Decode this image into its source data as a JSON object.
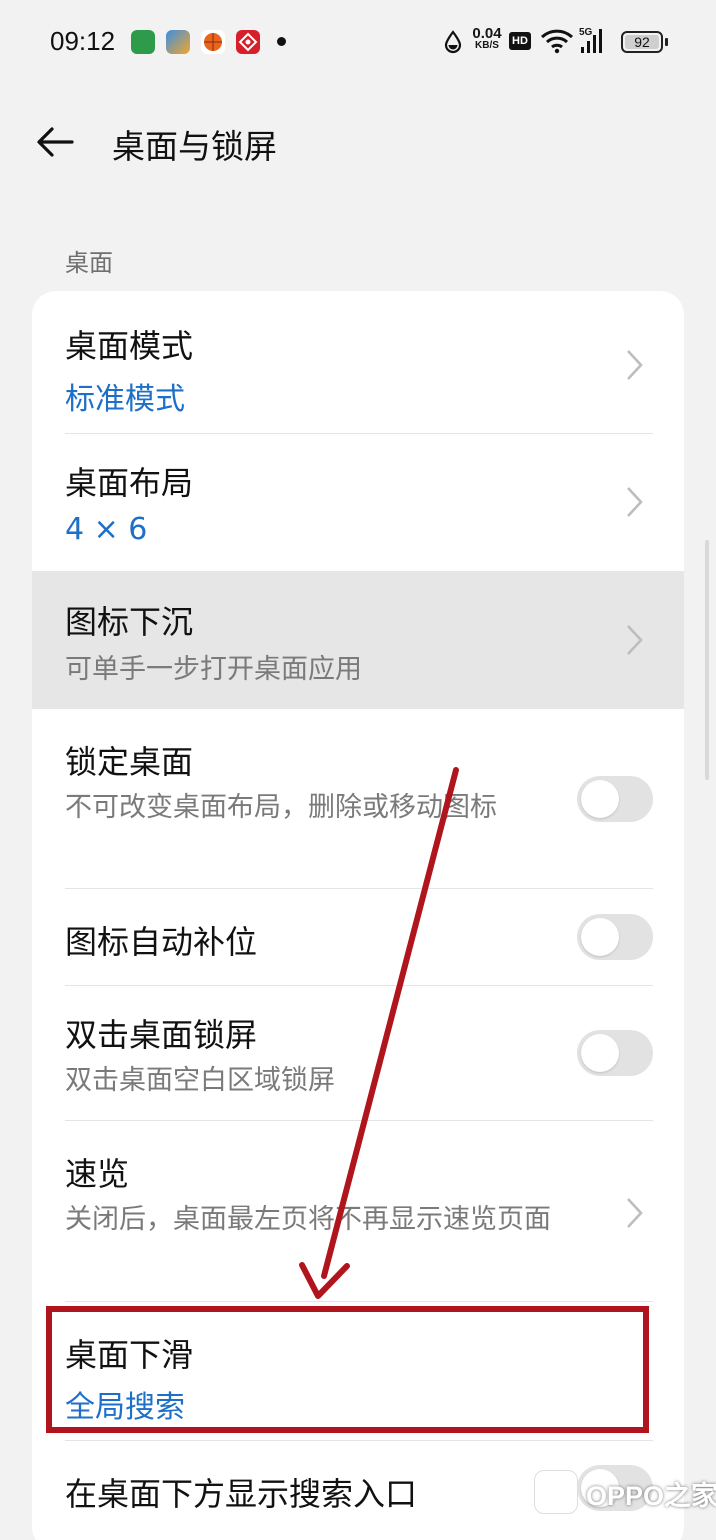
{
  "status_bar": {
    "time": "09:12",
    "app_icons": [
      "oppo-app-icon",
      "store-app-icon",
      "basketball-app-icon",
      "red-pattern-app-icon"
    ],
    "net_speed_value": "0.04",
    "net_speed_unit": "KB/S",
    "hd_label": "HD",
    "signal_label": "5G",
    "battery_level": "92",
    "icons": [
      "data-saver-icon",
      "wifi-icon",
      "signal-icon",
      "battery-icon"
    ]
  },
  "header": {
    "title": "桌面与锁屏",
    "back_icon": "arrow-left-icon"
  },
  "section": {
    "label": "桌面"
  },
  "items": [
    {
      "title": "桌面模式",
      "value": "标准模式",
      "control": "chevron"
    },
    {
      "title": "桌面布局",
      "value": "4 × 6",
      "control": "chevron"
    },
    {
      "title": "图标下沉",
      "subtitle": "可单手一步打开桌面应用",
      "control": "chevron",
      "pressed": true
    },
    {
      "title": "锁定桌面",
      "subtitle": "不可改变桌面布局，删除或移动图标",
      "control": "toggle",
      "toggle_on": false
    },
    {
      "title": "图标自动补位",
      "control": "toggle",
      "toggle_on": false
    },
    {
      "title": "双击桌面锁屏",
      "subtitle": "双击桌面空白区域锁屏",
      "control": "toggle",
      "toggle_on": false
    },
    {
      "title": "速览",
      "subtitle": "关闭后，桌面最左页将不再显示速览页面",
      "control": "chevron"
    },
    {
      "title": "桌面下滑",
      "value": "全局搜索",
      "control": "none",
      "highlighted": true
    },
    {
      "title": "在桌面下方显示搜索入口",
      "control": "toggle",
      "toggle_on": false
    }
  ],
  "colors": {
    "accent_value": "#1d6fc8",
    "annotation_red": "#b0151d",
    "background": "#f2f2f2"
  },
  "watermark": {
    "text": "OPPO之家"
  }
}
